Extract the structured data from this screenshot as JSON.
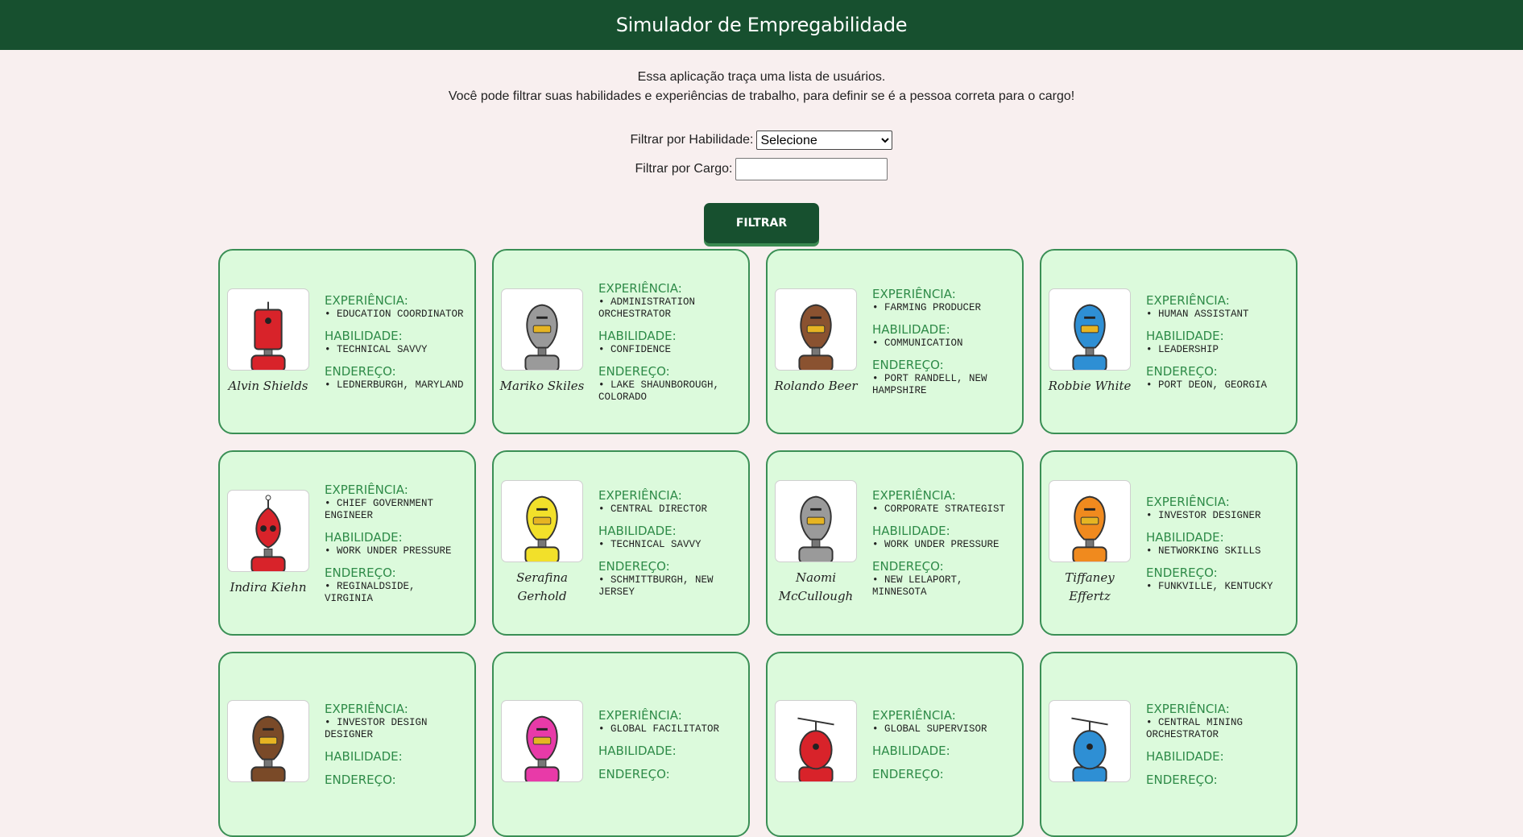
{
  "header": {
    "title": "Simulador de Empregabilidade"
  },
  "intro": {
    "line1": "Essa aplicação traça uma lista de usuários.",
    "line2": "Você pode filtrar suas habilidades e experiências de trabalho, para definir se é a pessoa correta para o cargo!"
  },
  "filters": {
    "habilidade_label": "Filtrar por Habilidade:",
    "habilidade_selected": "Selecione",
    "cargo_label": "Filtrar por Cargo:",
    "cargo_value": "",
    "button_label": "FILTRAR"
  },
  "labels": {
    "experiencia": "EXPERIÊNCIA:",
    "habilidade": "HABILIDADE:",
    "endereco": "ENDEREÇO:"
  },
  "cards": [
    {
      "name": "Alvin Shields",
      "experiencia": "• EDUCATION COORDINATOR",
      "habilidade": "• TECHNICAL SAVVY",
      "endereco": "• LEDNERBURGH, MARYLAND",
      "robot_color": "#d8232a",
      "robot_icon": "red-tall-robot-icon"
    },
    {
      "name": "Mariko Skiles",
      "experiencia": "• ADMINISTRATION ORCHESTRATOR",
      "habilidade": "• CONFIDENCE",
      "endereco": "• LAKE SHAUNBOROUGH, COLORADO",
      "robot_color": "#9a9a9a",
      "robot_icon": "gray-robot-icon"
    },
    {
      "name": "Rolando Beer",
      "experiencia": "• FARMING PRODUCER",
      "habilidade": "• COMMUNICATION",
      "endereco": "• PORT RANDELL, NEW HAMPSHIRE",
      "robot_color": "#8a5230",
      "robot_icon": "brown-robot-icon"
    },
    {
      "name": "Robbie White",
      "experiencia": "• HUMAN ASSISTANT",
      "habilidade": "• LEADERSHIP",
      "endereco": "• PORT DEON, GEORGIA",
      "robot_color": "#2e8fd4",
      "robot_icon": "blue-robot-icon"
    },
    {
      "name": "Indira Kiehn",
      "experiencia": "• CHIEF GOVERNMENT ENGINEER",
      "habilidade": "• WORK UNDER PRESSURE",
      "endereco": "• REGINALDSIDE, VIRGINIA",
      "robot_color": "#d8232a",
      "robot_icon": "red-round-robot-icon"
    },
    {
      "name": "Serafina Gerhold",
      "experiencia": "• CENTRAL DIRECTOR",
      "habilidade": "• TECHNICAL SAVVY",
      "endereco": "• SCHMITTBURGH, NEW JERSEY",
      "robot_color": "#f2e02a",
      "robot_icon": "yellow-robot-icon"
    },
    {
      "name": "Naomi McCullough",
      "experiencia": "• CORPORATE STRATEGIST",
      "habilidade": "• WORK UNDER PRESSURE",
      "endereco": "• NEW LELAPORT, MINNESOTA",
      "robot_color": "#9a9a9a",
      "robot_icon": "gray-robot-icon"
    },
    {
      "name": "Tiffaney Effertz",
      "experiencia": "• INVESTOR DESIGNER",
      "habilidade": "• NETWORKING SKILLS",
      "endereco": "• FUNKVILLE, KENTUCKY",
      "robot_color": "#f08a1e",
      "robot_icon": "orange-robot-icon"
    },
    {
      "name": "",
      "experiencia": "• INVESTOR DESIGN DESIGNER",
      "habilidade": "",
      "endereco": "",
      "robot_color": "#7a4a28",
      "robot_icon": "brown-robot-icon"
    },
    {
      "name": "",
      "experiencia": "• GLOBAL FACILITATOR",
      "habilidade": "",
      "endereco": "",
      "robot_color": "#e83aa8",
      "robot_icon": "pink-robot-icon"
    },
    {
      "name": "",
      "experiencia": "• GLOBAL SUPERVISOR",
      "habilidade": "",
      "endereco": "",
      "robot_color": "#d8232a",
      "robot_icon": "red-antenna-robot-icon"
    },
    {
      "name": "",
      "experiencia": "• CENTRAL MINING ORCHESTRATOR",
      "habilidade": "",
      "endereco": "",
      "robot_color": "#2e8fd4",
      "robot_icon": "blue-antenna-robot-icon"
    }
  ]
}
